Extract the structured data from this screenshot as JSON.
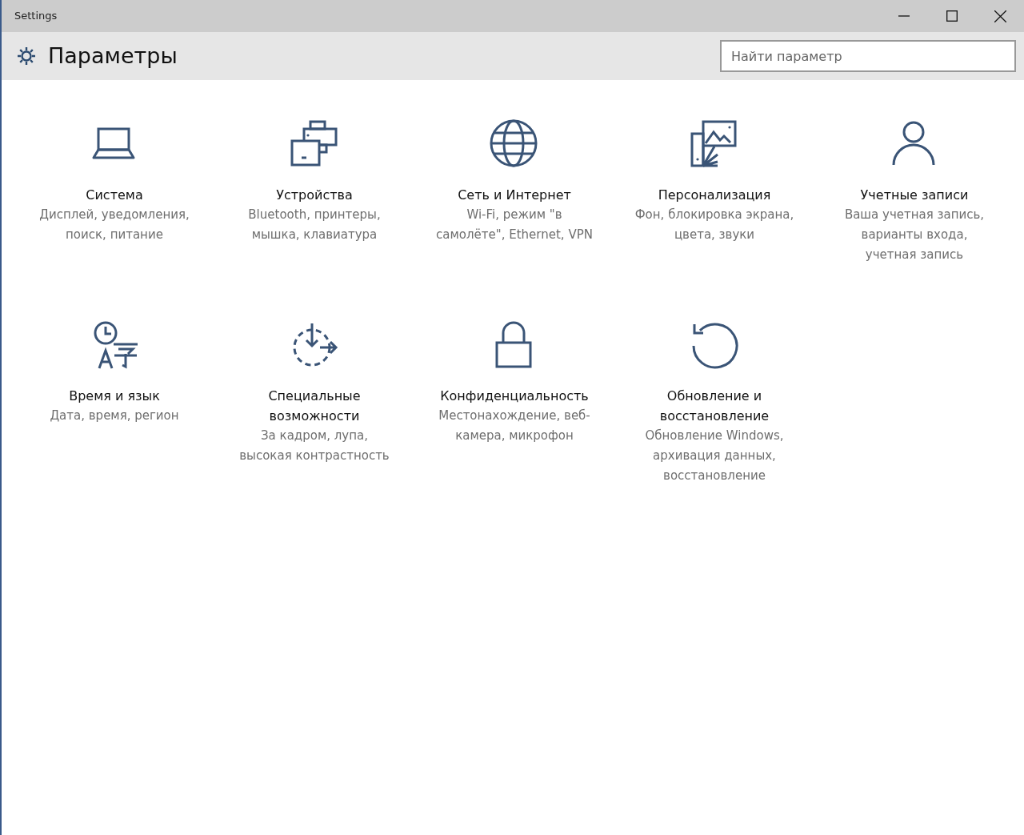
{
  "window": {
    "title": "Settings"
  },
  "header": {
    "title": "Параметры"
  },
  "search": {
    "placeholder": "Найти параметр"
  },
  "categories": [
    {
      "title": "Система",
      "description": "Дисплей, уведомления, поиск, питание"
    },
    {
      "title": "Устройства",
      "description": "Bluetooth, принтеры, мышка, клавиатура"
    },
    {
      "title": "Сеть и Интернет",
      "description": "Wi-Fi, режим \"в самолёте\", Ethernet, VPN"
    },
    {
      "title": "Персонализация",
      "description": "Фон, блокировка экрана, цвета, звуки"
    },
    {
      "title": "Учетные записи",
      "description": "Ваша учетная запись, варианты входа, учетная запись"
    },
    {
      "title": "Время и язык",
      "description": "Дата, время, регион"
    },
    {
      "title": "Специальные возможности",
      "description": "За кадром, лупа, высокая контрастность"
    },
    {
      "title": "Конфиденциальность",
      "description": "Местонахождение, веб-камера, микрофон"
    },
    {
      "title": "Обновление и восстановление",
      "description": "Обновление Windows, архивация данных, восстановление"
    }
  ]
}
